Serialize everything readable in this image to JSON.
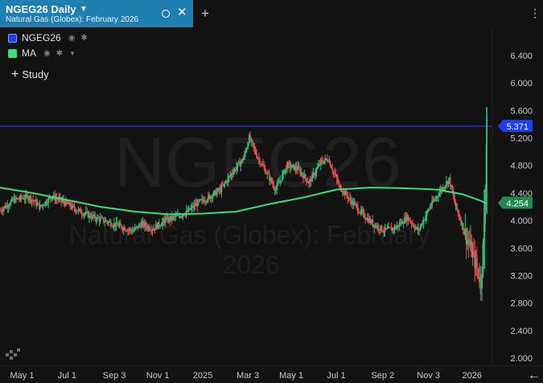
{
  "tab": {
    "title": "NGEG26 Daily",
    "subtitle": "Natural Gas (Globex): February 2026",
    "close_glyph": "✕",
    "add_glyph": "+",
    "more_glyph": "⋮"
  },
  "legend": [
    {
      "label": "NGEG26",
      "color": "#1b3dff"
    },
    {
      "label": "MA",
      "color": "#33e07a"
    }
  ],
  "study_button": "Study",
  "watermark": {
    "symbol": "NGEG26",
    "line1": "Natural Gas (Globex): February",
    "line2": "2026"
  },
  "colors": {
    "up": "#26c281",
    "down": "#e84d4d",
    "ma": "#33e07a",
    "price_line": "#2a3ccc",
    "price_badge": "#1b3dff",
    "ma_badge": "#1f8a4f",
    "grid": "#2a2a2a"
  },
  "chart_data": {
    "type": "candlestick",
    "y_ticks": [
      "6.400",
      "6.000",
      "5.600",
      "5.200",
      "4.800",
      "4.400",
      "4.000",
      "3.600",
      "3.200",
      "2.800",
      "2.400",
      "2.000"
    ],
    "ylim": [
      2.0,
      6.7
    ],
    "x_ticks": [
      "May 1",
      "Jul 1",
      "Sep 3",
      "Nov 1",
      "2025",
      "Mar 3",
      "May 1",
      "Jul 1",
      "Sep 2",
      "Nov 3",
      "2026"
    ],
    "x_tick_dates": [
      "2024-05-01",
      "2024-07-01",
      "2024-09-03",
      "2024-11-01",
      "2025-01-01",
      "2025-03-03",
      "2025-05-01",
      "2025-07-01",
      "2025-09-02",
      "2025-11-03",
      "2026-01-01"
    ],
    "x_range": [
      "2024-04-01",
      "2026-01-22"
    ],
    "last_price": "5.371",
    "ma_last": "4.254",
    "close_path": [
      [
        "2024-04-01",
        4.15
      ],
      [
        "2024-04-20",
        4.3
      ],
      [
        "2024-05-10",
        4.35
      ],
      [
        "2024-05-25",
        4.2
      ],
      [
        "2024-06-10",
        4.35
      ],
      [
        "2024-06-25",
        4.28
      ],
      [
        "2024-07-15",
        4.15
      ],
      [
        "2024-08-05",
        4.05
      ],
      [
        "2024-08-25",
        3.98
      ],
      [
        "2024-09-10",
        3.92
      ],
      [
        "2024-09-28",
        3.85
      ],
      [
        "2024-10-10",
        3.95
      ],
      [
        "2024-10-25",
        3.88
      ],
      [
        "2024-11-10",
        4.0
      ],
      [
        "2024-11-25",
        4.05
      ],
      [
        "2024-12-10",
        4.12
      ],
      [
        "2024-12-25",
        4.25
      ],
      [
        "2025-01-10",
        4.35
      ],
      [
        "2025-01-25",
        4.45
      ],
      [
        "2025-02-10",
        4.7
      ],
      [
        "2025-02-25",
        4.9
      ],
      [
        "2025-03-05",
        5.2
      ],
      [
        "2025-03-15",
        4.95
      ],
      [
        "2025-03-28",
        4.7
      ],
      [
        "2025-04-10",
        4.45
      ],
      [
        "2025-04-25",
        4.8
      ],
      [
        "2025-05-10",
        4.75
      ],
      [
        "2025-05-25",
        4.55
      ],
      [
        "2025-06-10",
        4.85
      ],
      [
        "2025-06-20",
        4.9
      ],
      [
        "2025-07-05",
        4.5
      ],
      [
        "2025-07-20",
        4.3
      ],
      [
        "2025-08-05",
        4.1
      ],
      [
        "2025-08-20",
        3.95
      ],
      [
        "2025-09-05",
        3.85
      ],
      [
        "2025-09-20",
        3.9
      ],
      [
        "2025-10-05",
        4.05
      ],
      [
        "2025-10-20",
        3.85
      ],
      [
        "2025-11-05",
        4.2
      ],
      [
        "2025-11-20",
        4.45
      ],
      [
        "2025-12-01",
        4.6
      ],
      [
        "2025-12-10",
        4.2
      ],
      [
        "2025-12-20",
        3.9
      ],
      [
        "2025-12-30",
        3.6
      ],
      [
        "2026-01-08",
        3.3
      ],
      [
        "2026-01-13",
        3.1
      ],
      [
        "2026-01-16",
        3.6
      ],
      [
        "2026-01-19",
        4.4
      ],
      [
        "2026-01-21",
        5.37
      ]
    ],
    "ma_path": [
      [
        "2024-04-01",
        4.48
      ],
      [
        "2024-05-15",
        4.4
      ],
      [
        "2024-07-01",
        4.3
      ],
      [
        "2024-08-15",
        4.2
      ],
      [
        "2024-10-01",
        4.13
      ],
      [
        "2024-11-15",
        4.09
      ],
      [
        "2025-01-01",
        4.1
      ],
      [
        "2025-02-15",
        4.13
      ],
      [
        "2025-04-01",
        4.24
      ],
      [
        "2025-05-15",
        4.33
      ],
      [
        "2025-07-01",
        4.45
      ],
      [
        "2025-08-15",
        4.48
      ],
      [
        "2025-10-01",
        4.47
      ],
      [
        "2025-11-15",
        4.45
      ],
      [
        "2025-12-20",
        4.38
      ],
      [
        "2026-01-10",
        4.3
      ],
      [
        "2026-01-21",
        4.25
      ]
    ]
  }
}
